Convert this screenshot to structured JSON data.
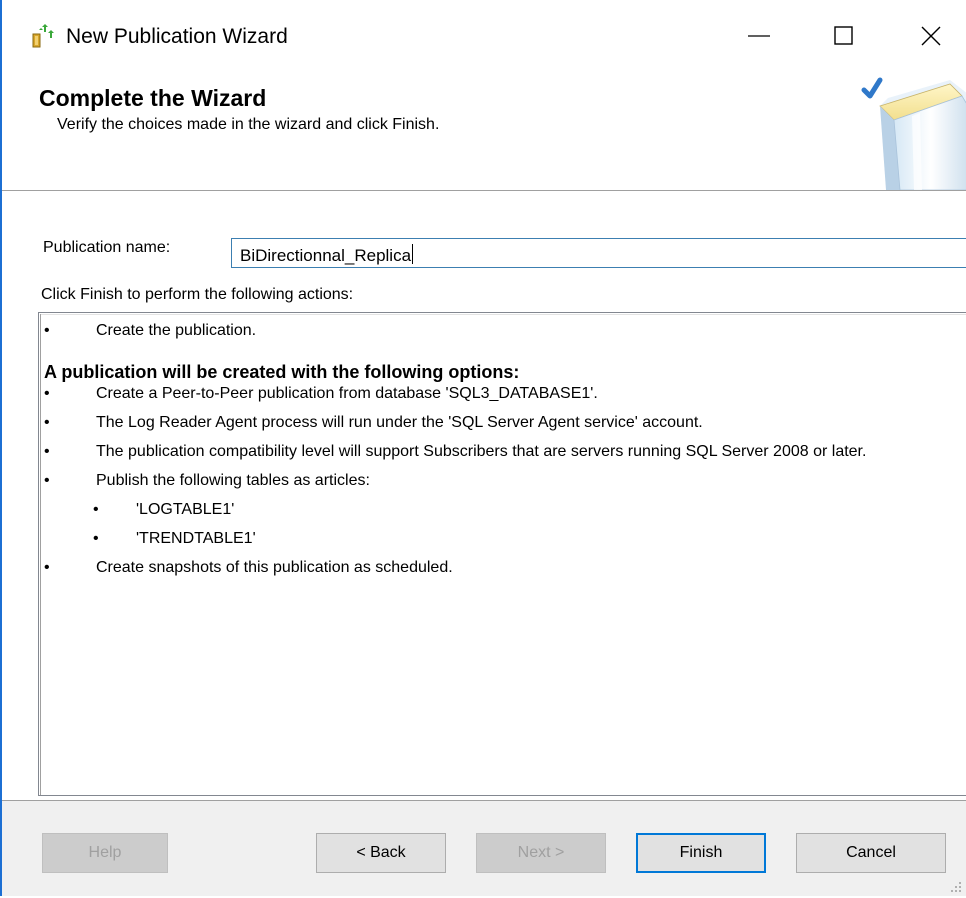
{
  "window": {
    "title": "New Publication Wizard",
    "minimize_label": "—",
    "close_label": "✕",
    "accent_color": "#1c6fd3"
  },
  "header": {
    "title": "Complete the Wizard",
    "subtitle": "Verify the choices made in the wizard and click Finish."
  },
  "form": {
    "publication_name_label": "Publication name:",
    "publication_name_value": "BiDirectionnal_Replica",
    "instructions": "Click Finish to perform the following actions:"
  },
  "actions": {
    "bullet": "•",
    "first_item": "Create the publication.",
    "section_title": "A publication will be created with the following options:",
    "options": [
      "Create a Peer-to-Peer publication from database 'SQL3_DATABASE1'.",
      "The Log Reader Agent process will run under the 'SQL Server Agent service' account.",
      "The publication compatibility level will support Subscribers that are servers running SQL Server 2008 or later.",
      "Publish the following tables as articles:"
    ],
    "articles": [
      "'LOGTABLE1'",
      "'TRENDTABLE1'"
    ],
    "last_item": "Create snapshots of this publication as scheduled."
  },
  "buttons": {
    "help": "Help",
    "back": "< Back",
    "next": "Next >",
    "finish": "Finish",
    "cancel": "Cancel"
  }
}
